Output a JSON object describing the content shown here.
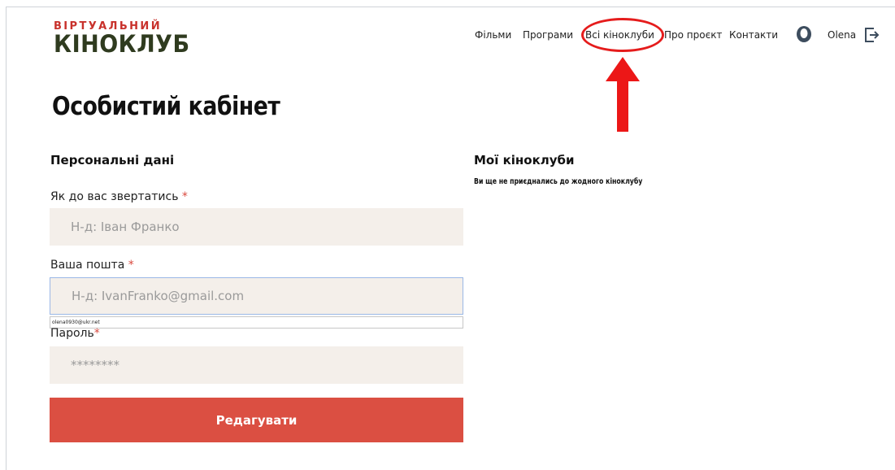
{
  "logo": {
    "line1": "ВІРТУАЛЬНИЙ",
    "line2": "КІНОКЛУБ"
  },
  "nav": {
    "items": [
      "Фільми",
      "Програми",
      "Всі кіноклуби",
      "Про проєкт",
      "Контакти"
    ],
    "user_name": "Olena"
  },
  "page_title": "Особистий кабінет",
  "personal": {
    "title": "Персональні дані",
    "name_label": "Як до вас звертатись",
    "name_placeholder": "Н-д: Іван Франко",
    "email_label": "Ваша пошта",
    "email_placeholder": "Н-д: IvanFranko@gmail.com",
    "email_suggestion": "olena0930@ukr.net",
    "password_label": "Пароль",
    "password_placeholder": "********",
    "required_mark": "*",
    "edit_button": "Редагувати"
  },
  "clubs": {
    "title": "Мої кіноклуби",
    "empty_text": "Ви ще не приєднались до жодного кіноклубу"
  },
  "colors": {
    "accent": "#db4f42",
    "logo_red": "#c8312b",
    "logo_dark": "#2f3b1f",
    "input_bg": "#f4efea",
    "annotation": "#e51c1c"
  }
}
